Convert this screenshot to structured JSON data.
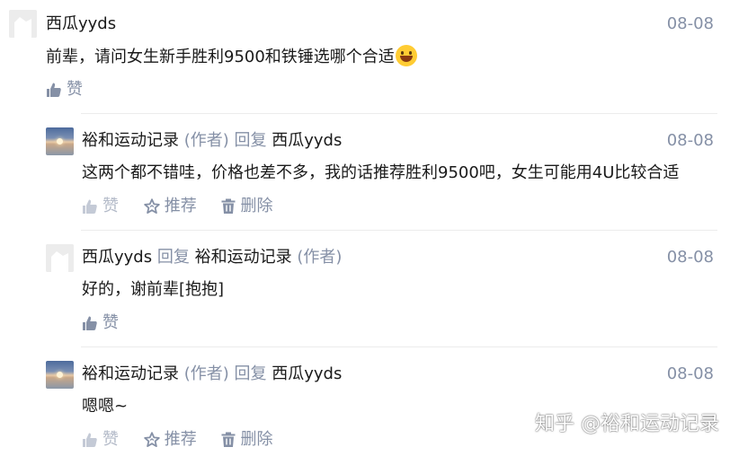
{
  "comments": [
    {
      "author": "西瓜yyds",
      "date": "08-08",
      "text": "前辈，请问女生新手胜利9500和铁锤选哪个合适",
      "emoji": "grinning-face",
      "like_label": "赞"
    },
    {
      "author": "裕和运动记录",
      "author_tag": "(作者)",
      "reply_word": "回复",
      "reply_to": "西瓜yyds",
      "date": "08-08",
      "text": "这两个都不错哇，价格也差不多，我的话推荐胜利9500吧，女生可能用4U比较合适",
      "like_label": "赞",
      "recommend_label": "推荐",
      "delete_label": "删除"
    },
    {
      "author": "西瓜yyds",
      "reply_word": "回复",
      "reply_to": "裕和运动记录",
      "reply_to_tag": "(作者)",
      "date": "08-08",
      "text": "好的，谢前辈[抱抱]",
      "like_label": "赞"
    },
    {
      "author": "裕和运动记录",
      "author_tag": "(作者)",
      "reply_word": "回复",
      "reply_to": "西瓜yyds",
      "date": "08-08",
      "text": "嗯嗯~",
      "like_label": "赞",
      "recommend_label": "推荐",
      "delete_label": "删除"
    }
  ],
  "watermark": "知乎 @裕和运动记录",
  "colors": {
    "muted": "#8590a6",
    "dim": "#b3bac8",
    "text": "#1a1a1a",
    "divider": "#ececec"
  }
}
